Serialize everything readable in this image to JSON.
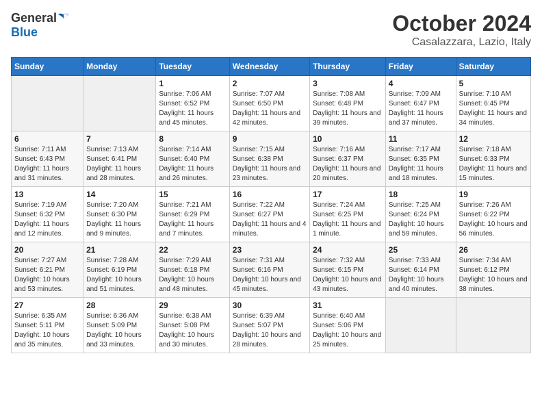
{
  "header": {
    "logo_general": "General",
    "logo_blue": "Blue",
    "month_title": "October 2024",
    "location": "Casalazzara, Lazio, Italy"
  },
  "days_of_week": [
    "Sunday",
    "Monday",
    "Tuesday",
    "Wednesday",
    "Thursday",
    "Friday",
    "Saturday"
  ],
  "weeks": [
    [
      {
        "day": "",
        "info": ""
      },
      {
        "day": "",
        "info": ""
      },
      {
        "day": "1",
        "info": "Sunrise: 7:06 AM\nSunset: 6:52 PM\nDaylight: 11 hours and 45 minutes."
      },
      {
        "day": "2",
        "info": "Sunrise: 7:07 AM\nSunset: 6:50 PM\nDaylight: 11 hours and 42 minutes."
      },
      {
        "day": "3",
        "info": "Sunrise: 7:08 AM\nSunset: 6:48 PM\nDaylight: 11 hours and 39 minutes."
      },
      {
        "day": "4",
        "info": "Sunrise: 7:09 AM\nSunset: 6:47 PM\nDaylight: 11 hours and 37 minutes."
      },
      {
        "day": "5",
        "info": "Sunrise: 7:10 AM\nSunset: 6:45 PM\nDaylight: 11 hours and 34 minutes."
      }
    ],
    [
      {
        "day": "6",
        "info": "Sunrise: 7:11 AM\nSunset: 6:43 PM\nDaylight: 11 hours and 31 minutes."
      },
      {
        "day": "7",
        "info": "Sunrise: 7:13 AM\nSunset: 6:41 PM\nDaylight: 11 hours and 28 minutes."
      },
      {
        "day": "8",
        "info": "Sunrise: 7:14 AM\nSunset: 6:40 PM\nDaylight: 11 hours and 26 minutes."
      },
      {
        "day": "9",
        "info": "Sunrise: 7:15 AM\nSunset: 6:38 PM\nDaylight: 11 hours and 23 minutes."
      },
      {
        "day": "10",
        "info": "Sunrise: 7:16 AM\nSunset: 6:37 PM\nDaylight: 11 hours and 20 minutes."
      },
      {
        "day": "11",
        "info": "Sunrise: 7:17 AM\nSunset: 6:35 PM\nDaylight: 11 hours and 18 minutes."
      },
      {
        "day": "12",
        "info": "Sunrise: 7:18 AM\nSunset: 6:33 PM\nDaylight: 11 hours and 15 minutes."
      }
    ],
    [
      {
        "day": "13",
        "info": "Sunrise: 7:19 AM\nSunset: 6:32 PM\nDaylight: 11 hours and 12 minutes."
      },
      {
        "day": "14",
        "info": "Sunrise: 7:20 AM\nSunset: 6:30 PM\nDaylight: 11 hours and 9 minutes."
      },
      {
        "day": "15",
        "info": "Sunrise: 7:21 AM\nSunset: 6:29 PM\nDaylight: 11 hours and 7 minutes."
      },
      {
        "day": "16",
        "info": "Sunrise: 7:22 AM\nSunset: 6:27 PM\nDaylight: 11 hours and 4 minutes."
      },
      {
        "day": "17",
        "info": "Sunrise: 7:24 AM\nSunset: 6:25 PM\nDaylight: 11 hours and 1 minute."
      },
      {
        "day": "18",
        "info": "Sunrise: 7:25 AM\nSunset: 6:24 PM\nDaylight: 10 hours and 59 minutes."
      },
      {
        "day": "19",
        "info": "Sunrise: 7:26 AM\nSunset: 6:22 PM\nDaylight: 10 hours and 56 minutes."
      }
    ],
    [
      {
        "day": "20",
        "info": "Sunrise: 7:27 AM\nSunset: 6:21 PM\nDaylight: 10 hours and 53 minutes."
      },
      {
        "day": "21",
        "info": "Sunrise: 7:28 AM\nSunset: 6:19 PM\nDaylight: 10 hours and 51 minutes."
      },
      {
        "day": "22",
        "info": "Sunrise: 7:29 AM\nSunset: 6:18 PM\nDaylight: 10 hours and 48 minutes."
      },
      {
        "day": "23",
        "info": "Sunrise: 7:31 AM\nSunset: 6:16 PM\nDaylight: 10 hours and 45 minutes."
      },
      {
        "day": "24",
        "info": "Sunrise: 7:32 AM\nSunset: 6:15 PM\nDaylight: 10 hours and 43 minutes."
      },
      {
        "day": "25",
        "info": "Sunrise: 7:33 AM\nSunset: 6:14 PM\nDaylight: 10 hours and 40 minutes."
      },
      {
        "day": "26",
        "info": "Sunrise: 7:34 AM\nSunset: 6:12 PM\nDaylight: 10 hours and 38 minutes."
      }
    ],
    [
      {
        "day": "27",
        "info": "Sunrise: 6:35 AM\nSunset: 5:11 PM\nDaylight: 10 hours and 35 minutes."
      },
      {
        "day": "28",
        "info": "Sunrise: 6:36 AM\nSunset: 5:09 PM\nDaylight: 10 hours and 33 minutes."
      },
      {
        "day": "29",
        "info": "Sunrise: 6:38 AM\nSunset: 5:08 PM\nDaylight: 10 hours and 30 minutes."
      },
      {
        "day": "30",
        "info": "Sunrise: 6:39 AM\nSunset: 5:07 PM\nDaylight: 10 hours and 28 minutes."
      },
      {
        "day": "31",
        "info": "Sunrise: 6:40 AM\nSunset: 5:06 PM\nDaylight: 10 hours and 25 minutes."
      },
      {
        "day": "",
        "info": ""
      },
      {
        "day": "",
        "info": ""
      }
    ]
  ]
}
